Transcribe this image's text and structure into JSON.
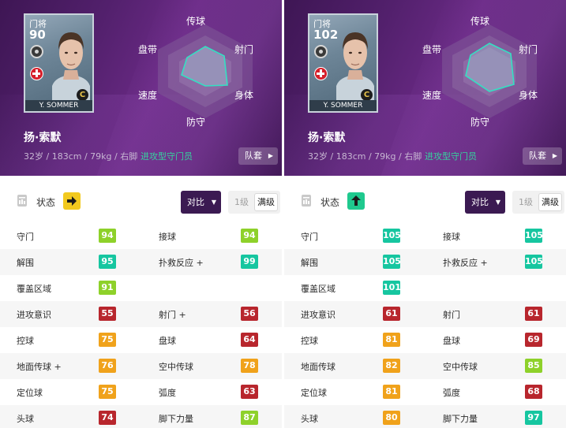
{
  "colors": {
    "red": "#b8262d",
    "orange": "#f0a21b",
    "yellow_green": "#8ed12a",
    "green": "#1fc98e",
    "teal": "#16c6a0"
  },
  "radar_labels": {
    "top": "传球",
    "upper_right": "射门",
    "lower_right": "身体",
    "bottom": "防守",
    "lower_left": "速度",
    "upper_left": "盘带"
  },
  "panels": [
    {
      "card": {
        "position": "门将",
        "rating": "90",
        "name": "Y. SOMMER",
        "badge": "C"
      },
      "player_name": "扬·索默",
      "info": "32岁 / 183cm / 79kg / 右脚",
      "play_style": "进攻型守门员",
      "squad_button": "队套",
      "status_label": "状态",
      "condition": {
        "icon": "right-arrow-icon",
        "color": "yellow"
      },
      "compare_button": "对比",
      "level_label": "1级",
      "max_level_button": "满级",
      "stats": [
        [
          {
            "name": "守门",
            "value": "94",
            "color": "yellow_green"
          },
          {
            "name": "接球",
            "value": "94",
            "color": "yellow_green"
          }
        ],
        [
          {
            "name": "解围",
            "value": "95",
            "color": "teal"
          },
          {
            "name": "扑救反应 +",
            "value": "99",
            "color": "teal"
          }
        ],
        [
          {
            "name": "覆盖区域",
            "value": "91",
            "color": "yellow_green"
          },
          null
        ],
        [
          {
            "name": "进攻意识",
            "value": "55",
            "color": "red"
          },
          {
            "name": "射门 +",
            "value": "56",
            "color": "red"
          }
        ],
        [
          {
            "name": "控球",
            "value": "75",
            "color": "orange"
          },
          {
            "name": "盘球",
            "value": "64",
            "color": "red"
          }
        ],
        [
          {
            "name": "地面传球 +",
            "value": "76",
            "color": "orange"
          },
          {
            "name": "空中传球",
            "value": "78",
            "color": "orange"
          }
        ],
        [
          {
            "name": "定位球",
            "value": "75",
            "color": "orange"
          },
          {
            "name": "弧度",
            "value": "63",
            "color": "red"
          }
        ],
        [
          {
            "name": "头球",
            "value": "74",
            "color": "red"
          },
          {
            "name": "脚下力量",
            "value": "87",
            "color": "yellow_green"
          }
        ]
      ]
    },
    {
      "card": {
        "position": "门将",
        "rating": "102",
        "name": "Y. SOMMER",
        "badge": "C"
      },
      "player_name": "扬·索默",
      "info": "32岁 / 183cm / 79kg / 右脚",
      "play_style": "进攻型守门员",
      "squad_button": "队套",
      "status_label": "状态",
      "condition": {
        "icon": "up-arrow-icon",
        "color": "green"
      },
      "compare_button": "对比",
      "level_label": "1级",
      "max_level_button": "满级",
      "stats": [
        [
          {
            "name": "守门",
            "value": "105",
            "color": "teal"
          },
          {
            "name": "接球",
            "value": "105",
            "color": "teal"
          }
        ],
        [
          {
            "name": "解围",
            "value": "105",
            "color": "teal"
          },
          {
            "name": "扑救反应 +",
            "value": "105",
            "color": "teal"
          }
        ],
        [
          {
            "name": "覆盖区域",
            "value": "101",
            "color": "teal"
          },
          null
        ],
        [
          {
            "name": "进攻意识",
            "value": "61",
            "color": "red"
          },
          {
            "name": "射门",
            "value": "61",
            "color": "red"
          }
        ],
        [
          {
            "name": "控球",
            "value": "81",
            "color": "orange"
          },
          {
            "name": "盘球",
            "value": "69",
            "color": "red"
          }
        ],
        [
          {
            "name": "地面传球",
            "value": "82",
            "color": "orange"
          },
          {
            "name": "空中传球",
            "value": "85",
            "color": "yellow_green"
          }
        ],
        [
          {
            "name": "定位球",
            "value": "81",
            "color": "orange"
          },
          {
            "name": "弧度",
            "value": "68",
            "color": "red"
          }
        ],
        [
          {
            "name": "头球",
            "value": "80",
            "color": "orange"
          },
          {
            "name": "脚下力量",
            "value": "97",
            "color": "teal"
          }
        ]
      ]
    }
  ]
}
